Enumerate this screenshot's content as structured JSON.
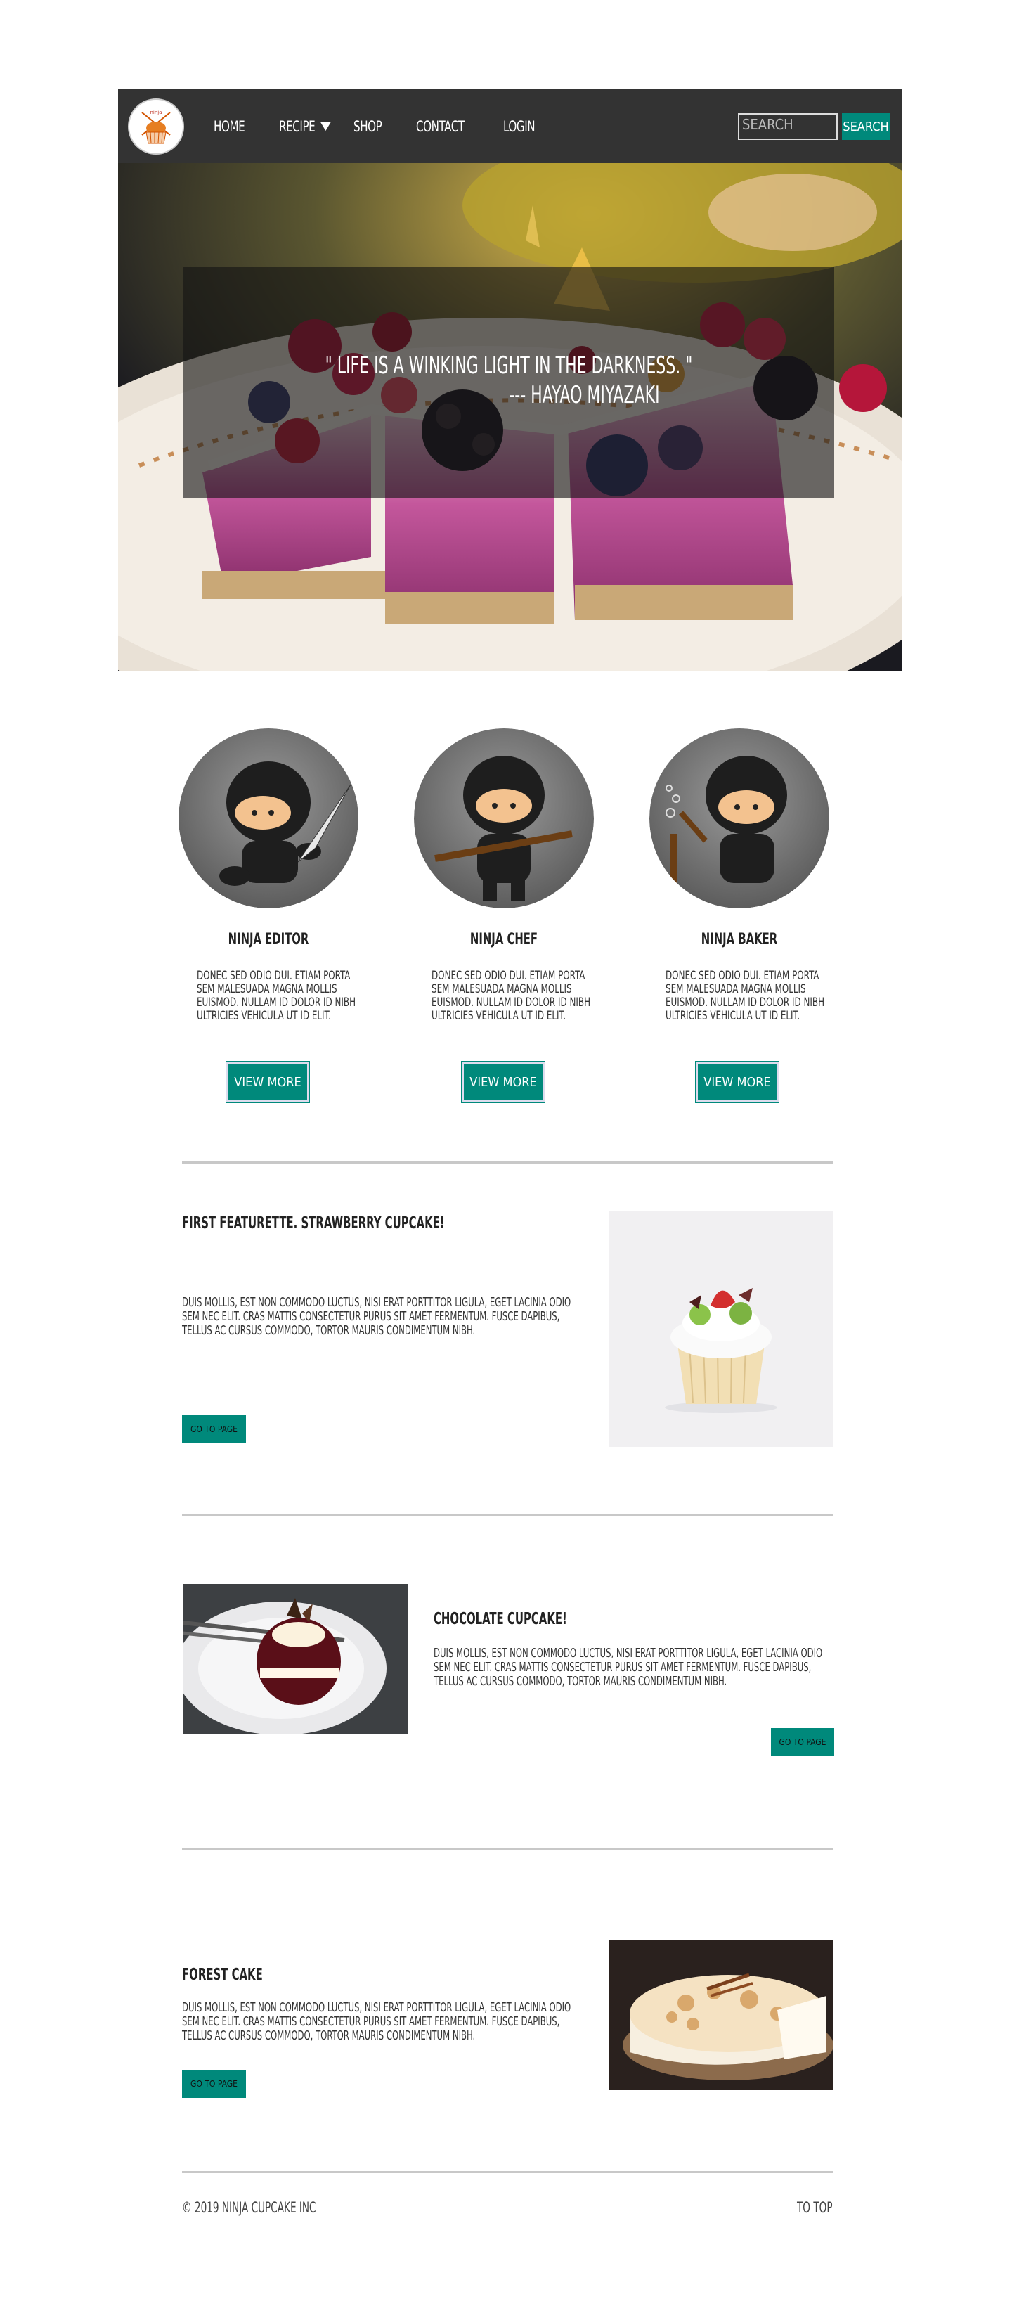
{
  "nav": {
    "items": [
      "HOME",
      "RECIPE",
      "SHOP",
      "CONTACT",
      "LOGIN"
    ],
    "search_placeholder": "SEARCH",
    "search_button": "SEARCH"
  },
  "hero": {
    "quote": "\" LIFE IS A WINKING LIGHT IN THE DARKNESS. \"",
    "author": "--- HAYAO MIYAZAKI"
  },
  "ninjas": [
    {
      "title": "NINJA EDITOR",
      "text": "DONEC SED ODIO DUI. ETIAM PORTA SEM MALESUADA MAGNA MOLLIS EUISMOD. NULLAM ID DOLOR ID NIBH ULTRICIES VEHICULA UT ID ELIT.",
      "button": "VIEW MORE"
    },
    {
      "title": "NINJA CHEF",
      "text": "DONEC SED ODIO DUI. ETIAM PORTA SEM MALESUADA MAGNA MOLLIS EUISMOD. NULLAM ID DOLOR ID NIBH ULTRICIES VEHICULA UT ID ELIT.",
      "button": "VIEW MORE"
    },
    {
      "title": "NINJA BAKER",
      "text": "DONEC SED ODIO DUI. ETIAM PORTA SEM MALESUADA MAGNA MOLLIS EUISMOD. NULLAM ID DOLOR ID NIBH ULTRICIES VEHICULA UT ID ELIT.",
      "button": "VIEW MORE"
    }
  ],
  "features": [
    {
      "title": "FIRST FEATURETTE. STRAWBERRY CUPCAKE!",
      "text": "DUIS MOLLIS, EST NON COMMODO LUCTUS, NISI ERAT PORTTITOR LIGULA, EGET LACINIA ODIO SEM NEC ELIT. CRAS MATTIS CONSECTETUR PURUS SIT AMET FERMENTUM. FUSCE DAPIBUS, TELLUS AC CURSUS COMMODO, TORTOR MAURIS CONDIMENTUM NIBH.",
      "button": "GO TO PAGE"
    },
    {
      "title": "CHOCOLATE CUPCAKE!",
      "text": "DUIS MOLLIS, EST NON COMMODO LUCTUS, NISI ERAT PORTTITOR LIGULA, EGET LACINIA ODIO SEM NEC ELIT. CRAS MATTIS CONSECTETUR PURUS SIT AMET FERMENTUM. FUSCE DAPIBUS, TELLUS AC CURSUS COMMODO, TORTOR MAURIS CONDIMENTUM NIBH.",
      "button": "GO TO PAGE"
    },
    {
      "title": "FOREST CAKE",
      "text": "DUIS MOLLIS, EST NON COMMODO LUCTUS, NISI ERAT PORTTITOR LIGULA, EGET LACINIA ODIO SEM NEC ELIT. CRAS MATTIS CONSECTETUR PURUS SIT AMET FERMENTUM. FUSCE DAPIBUS, TELLUS AC CURSUS COMMODO, TORTOR MAURIS CONDIMENTUM NIBH.",
      "button": "GO TO PAGE"
    }
  ],
  "footer": {
    "copyright": "© 2019 NINJA CUPCAKE INC",
    "to_top": "TO TOP"
  },
  "colors": {
    "accent": "#00897b",
    "navbar": "#333333"
  }
}
